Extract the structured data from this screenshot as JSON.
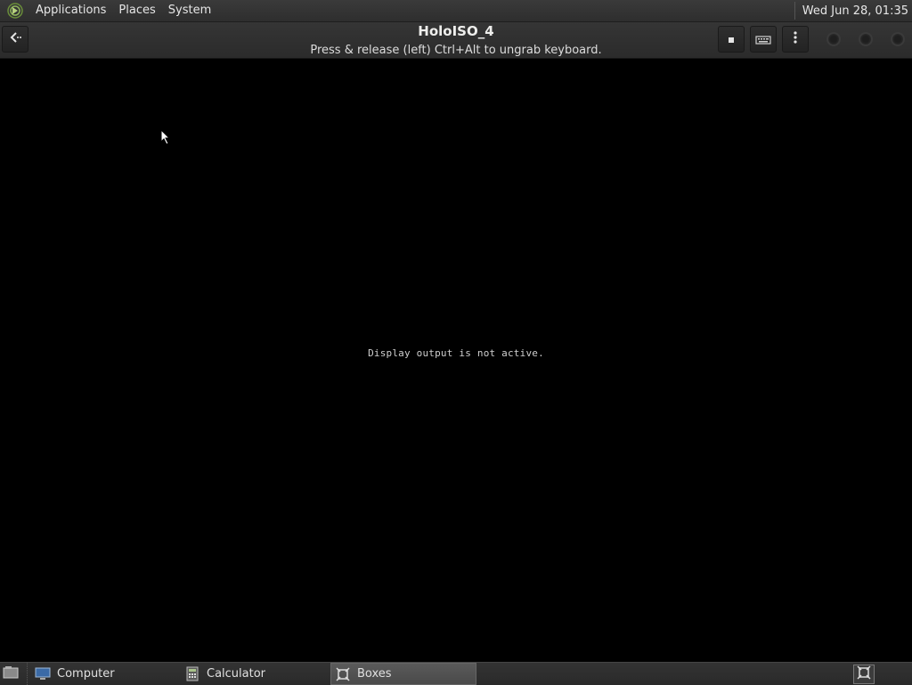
{
  "top_panel": {
    "menus": [
      "Applications",
      "Places",
      "System"
    ],
    "clock": "Wed Jun 28, 01:35"
  },
  "header": {
    "title": "HoloISO_4",
    "subtitle": "Press & release (left) Ctrl+Alt to ungrab keyboard.",
    "buttons": {
      "back": "back-arrow-icon",
      "stop": "stop-icon",
      "keyboard": "keyboard-icon",
      "more": "kebab-menu-icon"
    }
  },
  "vm": {
    "message": "Display output is not active."
  },
  "taskbar": {
    "tasks": [
      {
        "label": "Computer",
        "icon": "computer-icon",
        "active": false
      },
      {
        "label": "Calculator",
        "icon": "calculator-icon",
        "active": false
      },
      {
        "label": "Boxes",
        "icon": "boxes-icon",
        "active": true
      }
    ]
  },
  "colors": {
    "panel_bg": "#2e2e2e",
    "vm_bg": "#000000",
    "text": "#e6e6e6"
  }
}
